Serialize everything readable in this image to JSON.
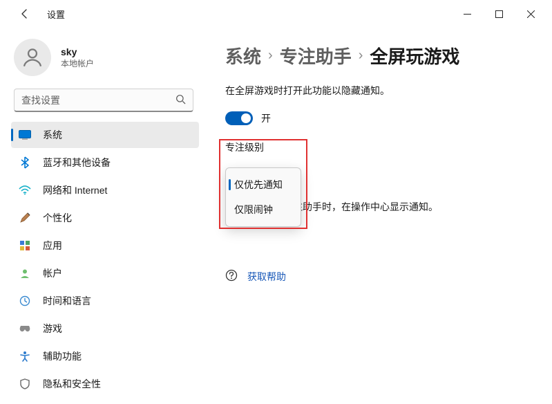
{
  "window": {
    "app_title": "设置"
  },
  "profile": {
    "name": "sky",
    "sub": "本地帐户"
  },
  "search": {
    "placeholder": "查找设置"
  },
  "nav": {
    "items": [
      {
        "label": "系统"
      },
      {
        "label": "蓝牙和其他设备"
      },
      {
        "label": "网络和 Internet"
      },
      {
        "label": "个性化"
      },
      {
        "label": "应用"
      },
      {
        "label": "帐户"
      },
      {
        "label": "时间和语言"
      },
      {
        "label": "游戏"
      },
      {
        "label": "辅助功能"
      },
      {
        "label": "隐私和安全性"
      }
    ]
  },
  "breadcrumb": {
    "l1": "系统",
    "l2": "专注助手",
    "current": "全屏玩游戏"
  },
  "page": {
    "description": "在全屏游戏时打开此功能以隐藏通知。",
    "toggle_label": "开",
    "section_title": "专注级别",
    "checkbox_label": "自动开启专注助手时，在操作中心显示通知。",
    "help_label": "获取帮助"
  },
  "dropdown": {
    "opt1": "仅优先通知",
    "opt2": "仅限闹钟"
  }
}
